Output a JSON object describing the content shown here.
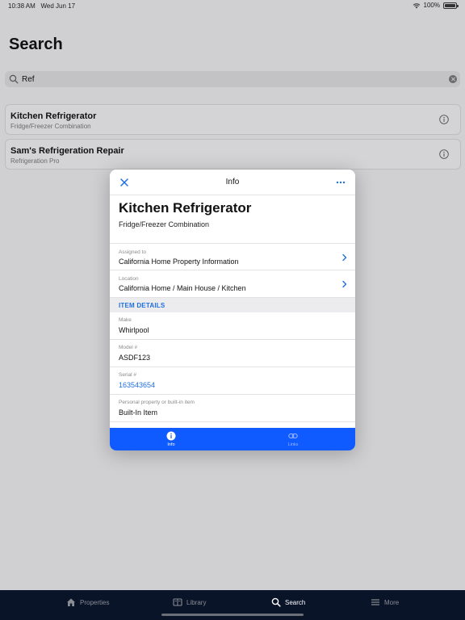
{
  "status_bar": {
    "time": "10:38 AM",
    "date": "Wed Jun 17",
    "battery": "100%"
  },
  "page": {
    "title": "Search"
  },
  "search": {
    "value": "Ref"
  },
  "results": [
    {
      "title": "Kitchen Refrigerator",
      "subtitle": "Fridge/Freezer Combination"
    },
    {
      "title": "Sam's Refrigeration Repair",
      "subtitle": "Refrigeration Pro"
    }
  ],
  "modal": {
    "header_title": "Info",
    "item_title": "Kitchen Refrigerator",
    "item_subtitle": "Fridge/Freezer Combination",
    "assigned_to": {
      "label": "Assigned to",
      "value": "California Home Property Information"
    },
    "location": {
      "label": "Location",
      "value": "California Home / Main House / Kitchen"
    },
    "section_title": "ITEM DETAILS",
    "make": {
      "label": "Make",
      "value": "Whirlpool"
    },
    "model": {
      "label": "Model #",
      "value": "ASDF123"
    },
    "serial": {
      "label": "Serial #",
      "value": "163543654"
    },
    "property_type": {
      "label": "Personal property or built-in item",
      "value": "Built-In Item"
    },
    "tabs": {
      "info": "Info",
      "links": "Links"
    }
  },
  "tabbar": {
    "properties": "Properties",
    "library": "Library",
    "search": "Search",
    "more": "More"
  },
  "colors": {
    "accent": "#1e6fe0",
    "modal_tab_bg": "#0f5bff",
    "tabbar_bg": "#0a1429"
  }
}
